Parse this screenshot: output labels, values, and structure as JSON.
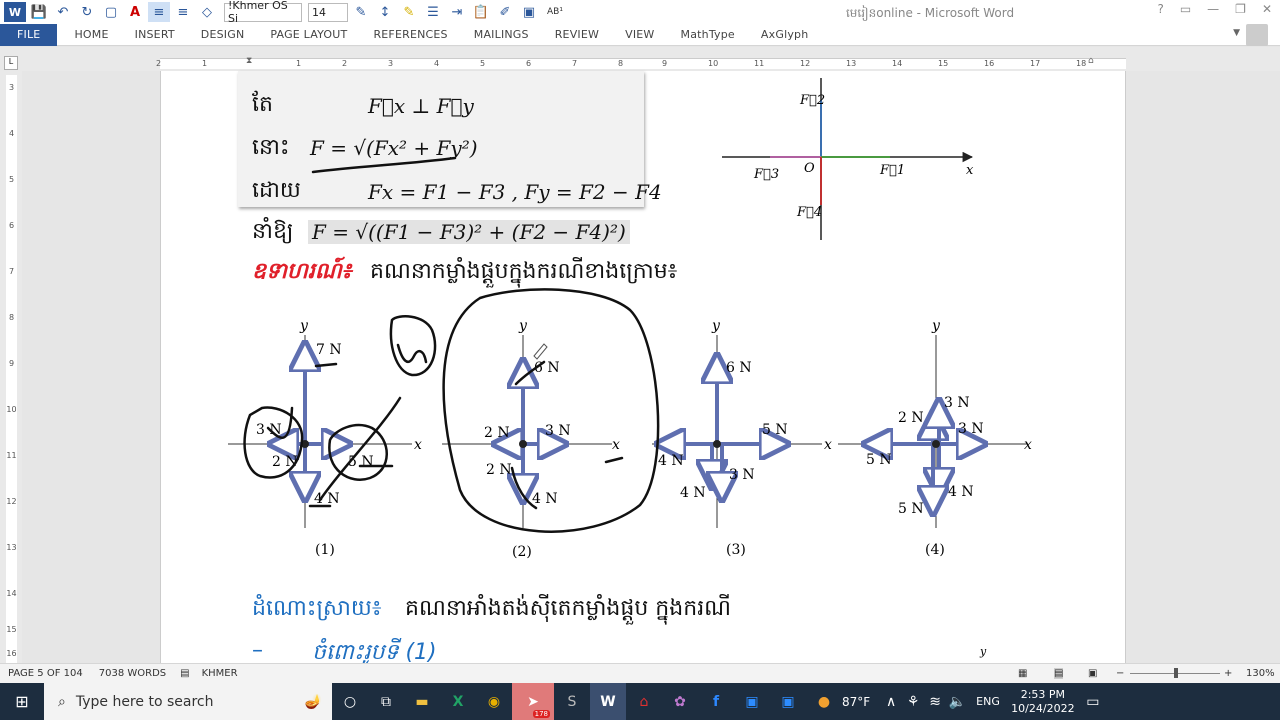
{
  "window": {
    "title": "មេរៀនonline - Microsoft Word"
  },
  "qat": {
    "font_name": "!Khmer OS Si",
    "font_size": "14",
    "style_label": "AB¹"
  },
  "ribbon": {
    "tabs": [
      "FILE",
      "HOME",
      "INSERT",
      "DESIGN",
      "PAGE LAYOUT",
      "REFERENCES",
      "MAILINGS",
      "REVIEW",
      "VIEW",
      "MathType",
      "AxGlyph"
    ]
  },
  "ruler": {
    "ticks": [
      "2",
      "1",
      "1",
      "2",
      "3",
      "4",
      "5",
      "6",
      "7",
      "8",
      "9",
      "10",
      "11",
      "12",
      "13",
      "14",
      "15",
      "16",
      "17",
      "18"
    ]
  },
  "vruler": {
    "ticks": [
      "3",
      "4",
      "5",
      "6",
      "7",
      "8",
      "9",
      "10",
      "11",
      "12",
      "13",
      "14",
      "15",
      "16"
    ]
  },
  "doc": {
    "box_lines": [
      {
        "word": "តែ",
        "math": "F⃗x ⊥ F⃗y"
      },
      {
        "word": "នោះ",
        "math": "F = √(Fx² + Fy²)"
      },
      {
        "word": "ដោយ",
        "math": "Fx = F1 − F3 ,  Fy = F2 − F4"
      }
    ],
    "result_word": "នាំឱ្យ",
    "result_math": "F = √((F1 − F3)² + (F2 − F4)²)",
    "example_label": "ឧទាហរណ៍៖",
    "example_text": "គណនាកម្លាំងផ្តួបក្នុងករណីខាងក្រោម៖",
    "solution_label": "ដំណោះស្រាយ៖",
    "solution_text": "គណនាអាំងតង់ស៊ីតេកម្លាំងផ្តួប ក្នុងករណី",
    "case_prefix": "–",
    "case_text": "ចំពោះរូបទី (1)",
    "axis_diagram": {
      "f2": "F⃗2",
      "f3": "F⃗3",
      "f1": "F⃗1",
      "f4": "F⃗4",
      "origin": "O",
      "x": "x"
    },
    "diagrams": [
      {
        "caption": "(1)",
        "x": "x",
        "y": "y",
        "labels": [
          "7 N",
          "3 N",
          "5 N",
          "2 N",
          "4 N"
        ]
      },
      {
        "caption": "(2)",
        "x": "x",
        "y": "y",
        "labels": [
          "6 N",
          "2 N",
          "3 N",
          "2 N",
          "4 N"
        ]
      },
      {
        "caption": "(3)",
        "x": "x",
        "y": "y",
        "labels": [
          "6 N",
          "5 N",
          "4 N",
          "3 N",
          "4 N"
        ]
      },
      {
        "caption": "(4)",
        "x": "x",
        "y": "y",
        "labels": [
          "3 N",
          "2 N",
          "3 N",
          "5 N",
          "4 N",
          "5 N"
        ]
      }
    ],
    "corner_y": "y"
  },
  "status": {
    "page": "PAGE 5 OF 104",
    "words": "7038 WORDS",
    "lang": "KHMER",
    "zoom": "130%"
  },
  "taskbar": {
    "search_placeholder": "Type here to search",
    "weather": "87°F",
    "lang": "ENG",
    "time": "2:53 PM",
    "date": "10/24/2022",
    "badge": "178"
  },
  "colors": {
    "accent": "#2b579a",
    "example": "#e0202a",
    "solution": "#1f6fc0",
    "vector": "#5f6fb0"
  }
}
